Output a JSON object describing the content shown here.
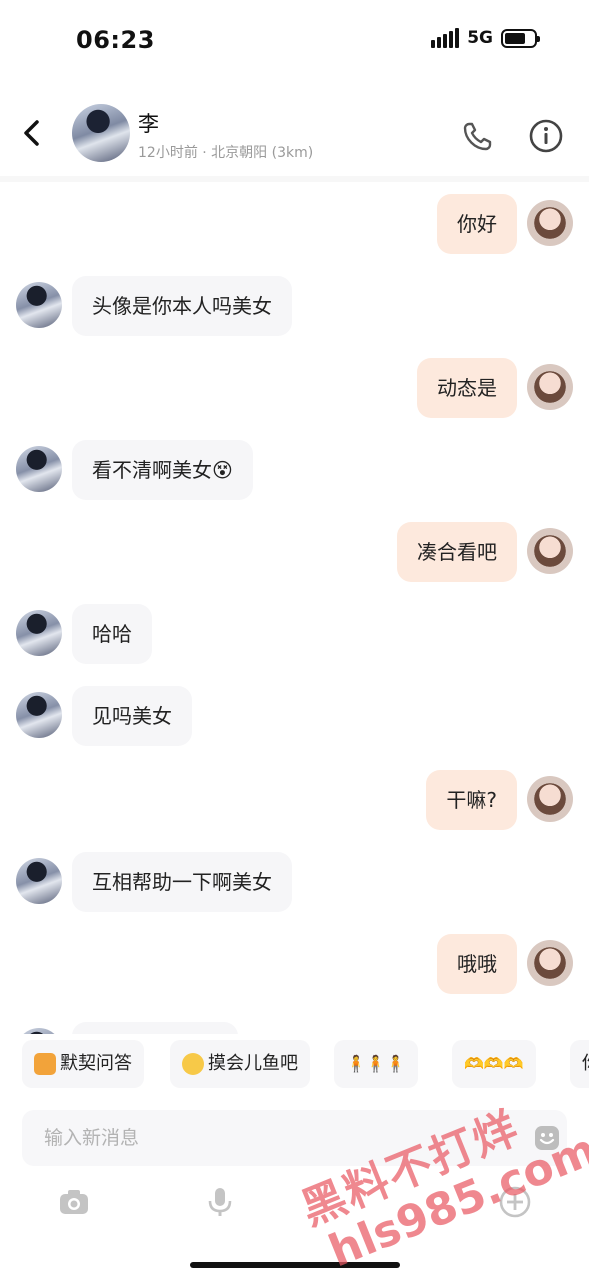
{
  "status_bar": {
    "time": "06:23",
    "network": "5G"
  },
  "header": {
    "name": "李",
    "subtitle": "12小时前 · 北京朝阳 (3km)"
  },
  "messages": [
    {
      "from": "me",
      "text": "你好"
    },
    {
      "from": "other",
      "text": "头像是你本人吗美女"
    },
    {
      "from": "me",
      "text": "动态是"
    },
    {
      "from": "other",
      "text": "看不清啊美女😵"
    },
    {
      "from": "me",
      "text": "凑合看吧"
    },
    {
      "from": "other",
      "text": "哈哈"
    },
    {
      "from": "other",
      "text": "见吗美女"
    },
    {
      "from": "me",
      "text": "干嘛?"
    },
    {
      "from": "other",
      "text": "互相帮助一下啊美女"
    },
    {
      "from": "me",
      "text": "哦哦"
    }
  ],
  "quick_replies": [
    {
      "label": "默契问答",
      "icon": "notepad-icon"
    },
    {
      "label": "摸会儿鱼吧",
      "icon": "fish-emoji-icon"
    },
    {
      "label": "🧍🧍🧍",
      "icon": ""
    },
    {
      "label": "🫶🫶🫶",
      "icon": ""
    },
    {
      "label": "你",
      "icon": ""
    }
  ],
  "input": {
    "placeholder": "输入新消息"
  },
  "toolbar": [
    "camera-icon",
    "microphone-icon",
    "plus-icon"
  ],
  "watermark": {
    "line1": "黑料不打烊",
    "line2": "hls985.com"
  },
  "colors": {
    "bubble_me": "#fde9dd",
    "bubble_other": "#f6f6f8",
    "watermark": "#e95a64"
  }
}
